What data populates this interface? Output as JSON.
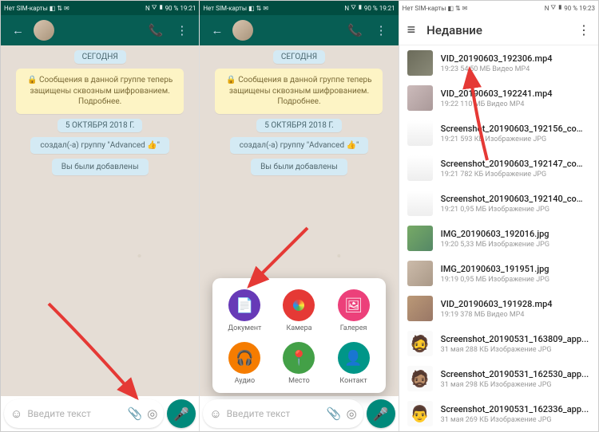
{
  "statusbar": {
    "sim": "Нет SIM-карты",
    "battery": "90 %",
    "time_a": "19:21",
    "time_c": "19:23",
    "nfc": "N"
  },
  "chat": {
    "today": "СЕГОДНЯ",
    "encryption": "🔒 Сообщения в данной группе теперь защищены сквозным шифрованием. Подробнее.",
    "date": "5 ОКТЯБРЯ 2018 Г.",
    "created": "создал(-а) группу \"Advanced 👍\"",
    "added": "Вы были добавлены",
    "placeholder": "Введите текст"
  },
  "attach": {
    "document": "Документ",
    "camera": "Камера",
    "gallery": "Галерея",
    "audio": "Аудио",
    "location": "Место",
    "contact": "Контакт"
  },
  "filepicker": {
    "title": "Недавние",
    "files": [
      {
        "name": "VID_20190603_192306.mp4",
        "meta": "19:23 54,50 МБ Видео MP4",
        "thumb": "linear-gradient(135deg,#6b6b5a,#8a8a78)"
      },
      {
        "name": "VID_20190603_192241.mp4",
        "meta": "19:22 110 МБ Видео MP4",
        "thumb": "linear-gradient(135deg,#cbb,#a99)"
      },
      {
        "name": "Screenshot_20190603_192156_com...",
        "meta": "19:21 593 КБ Изображение JPG",
        "thumb": "linear-gradient(#fff,#eee)"
      },
      {
        "name": "Screenshot_20190603_192147_com...",
        "meta": "19:21 782 КБ Изображение JPG",
        "thumb": "linear-gradient(#fff,#eee)"
      },
      {
        "name": "Screenshot_20190603_192140_com...",
        "meta": "19:21 0,95 МБ Изображение JPG",
        "thumb": "linear-gradient(#fff,#eee)"
      },
      {
        "name": "IMG_20190603_192016.jpg",
        "meta": "19:20 5,33 МБ Изображение JPG",
        "thumb": "linear-gradient(135deg,#7a6,#586)"
      },
      {
        "name": "IMG_20190603_191951.jpg",
        "meta": "19:19 0,95 МБ Изображение JPG",
        "thumb": "linear-gradient(135deg,#cba,#a98)"
      },
      {
        "name": "VID_20190603_191928.mp4",
        "meta": "19:19 378 МБ Видео MP4",
        "thumb": "linear-gradient(135deg,#b97,#976)"
      },
      {
        "name": "Screenshot_20190531_163809_app...",
        "meta": "31 мая 288 КБ Изображение JPG",
        "thumb": "emoji",
        "emoji": "🧔"
      },
      {
        "name": "Screenshot_20190531_162530_app...",
        "meta": "31 мая 298 КБ Изображение JPG",
        "thumb": "emoji",
        "emoji": "🧔🏽"
      },
      {
        "name": "Screenshot_20190531_162336_app...",
        "meta": "31 мая 269 КБ Изображение JPG",
        "thumb": "emoji",
        "emoji": "👨"
      }
    ]
  }
}
